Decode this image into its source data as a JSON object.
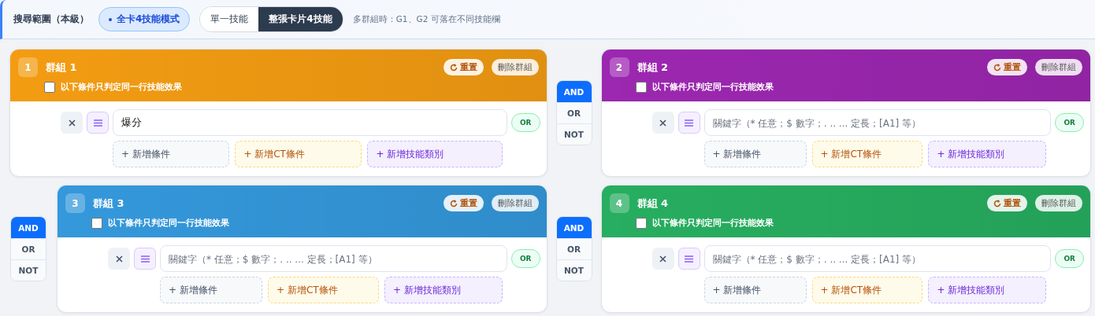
{
  "scope_bar": {
    "label": "搜尋範圍（本級）",
    "mode_chip": "全卡4技能模式",
    "segments": [
      {
        "label": "單一技能",
        "selected": false
      },
      {
        "label": "整張卡片4技能",
        "selected": true
      }
    ],
    "hint": "多群組時：G1、G2 可落在不同技能欄"
  },
  "groups": [
    {
      "number": "1",
      "title": "群組 1",
      "color": "#f39c12",
      "same_row_only": {
        "label": "以下條件只判定同一行技能效果",
        "checked": false
      },
      "reset": "重置",
      "delete": "刪除群組",
      "conditions": [
        {
          "value": "爆分",
          "logic": "OR"
        }
      ],
      "add_buttons": [
        {
          "kind": "condition",
          "label": "+ 新增條件"
        },
        {
          "kind": "ct",
          "label": "+ 新增CT條件"
        },
        {
          "kind": "category",
          "label": "+ 新增技能類別"
        }
      ]
    },
    {
      "connector": [
        {
          "label": "AND",
          "selected": true
        },
        {
          "label": "OR",
          "selected": false
        },
        {
          "label": "NOT",
          "selected": false
        }
      ],
      "number": "2",
      "title": "群組 2",
      "color": "#9c27b0",
      "same_row_only": {
        "label": "以下條件只判定同一行技能效果",
        "checked": false
      },
      "reset": "重置",
      "delete": "刪除群組",
      "conditions": [
        {
          "placeholder": "關鍵字（* 任意；$ 數字；. .. ... 定長；[A1] 等）",
          "logic": "OR"
        }
      ],
      "add_buttons": [
        {
          "kind": "condition",
          "label": "+ 新增條件"
        },
        {
          "kind": "ct",
          "label": "+ 新增CT條件"
        },
        {
          "kind": "category",
          "label": "+ 新增技能類別"
        }
      ]
    },
    {
      "connector": [
        {
          "label": "AND",
          "selected": true
        },
        {
          "label": "OR",
          "selected": false
        },
        {
          "label": "NOT",
          "selected": false
        }
      ],
      "number": "3",
      "title": "群組 3",
      "color": "#3498db",
      "same_row_only": {
        "label": "以下條件只判定同一行技能效果",
        "checked": false
      },
      "reset": "重置",
      "delete": "刪除群組",
      "conditions": [
        {
          "placeholder": "關鍵字（* 任意；$ 數字；. .. ... 定長；[A1] 等）",
          "logic": "OR"
        }
      ],
      "add_buttons": [
        {
          "kind": "condition",
          "label": "+ 新增條件"
        },
        {
          "kind": "ct",
          "label": "+ 新增CT條件"
        },
        {
          "kind": "category",
          "label": "+ 新增技能類別"
        }
      ]
    },
    {
      "connector": [
        {
          "label": "AND",
          "selected": true
        },
        {
          "label": "OR",
          "selected": false
        },
        {
          "label": "NOT",
          "selected": false
        }
      ],
      "number": "4",
      "title": "群組 4",
      "color": "#27ae60",
      "same_row_only": {
        "label": "以下條件只判定同一行技能效果",
        "checked": false
      },
      "reset": "重置",
      "delete": "刪除群組",
      "conditions": [
        {
          "placeholder": "關鍵字（* 任意；$ 數字；. .. ... 定長；[A1] 等）",
          "logic": "OR"
        }
      ],
      "add_buttons": [
        {
          "kind": "condition",
          "label": "+ 新增條件"
        },
        {
          "kind": "ct",
          "label": "+ 新增CT條件"
        },
        {
          "kind": "category",
          "label": "+ 新增技能類別"
        }
      ]
    }
  ]
}
